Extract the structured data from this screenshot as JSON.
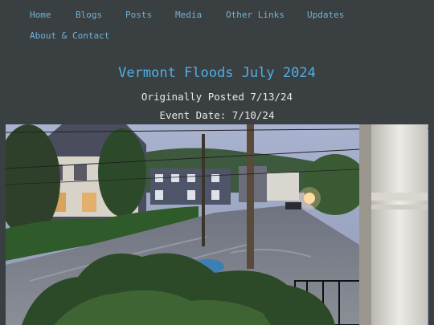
{
  "nav": {
    "items": [
      {
        "label": "Home"
      },
      {
        "label": "Blogs"
      },
      {
        "label": "Posts"
      },
      {
        "label": "Media"
      },
      {
        "label": "Other Links"
      },
      {
        "label": "Updates"
      },
      {
        "label": "About & Contact"
      }
    ]
  },
  "post": {
    "title": "Vermont Floods July 2024",
    "posted": "Originally Posted 7/13/24",
    "event_date": "Event Date: 7/10/24"
  },
  "colors": {
    "background": "#3a3f41",
    "nav_link": "#6fb3d7",
    "title": "#4fb0e6",
    "text": "#e9e9e9"
  }
}
